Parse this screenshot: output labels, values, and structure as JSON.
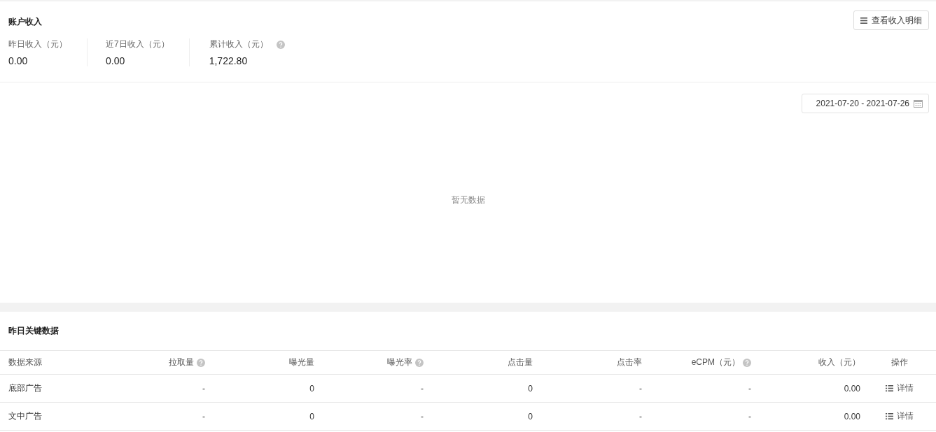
{
  "income": {
    "title": "账户收入",
    "detail_button": "查看收入明细",
    "stats": [
      {
        "label": "昨日收入（元）",
        "value": "0.00",
        "help": false
      },
      {
        "label": "近7日收入（元）",
        "value": "0.00",
        "help": false
      },
      {
        "label": "累计收入（元）",
        "value": "1,722.80",
        "help": true
      }
    ]
  },
  "chart": {
    "date_range": "2021-07-20 - 2021-07-26",
    "empty_text": "暂无数据"
  },
  "key_data": {
    "title": "昨日关键数据",
    "columns": [
      {
        "label": "数据来源",
        "help": false
      },
      {
        "label": "拉取量",
        "help": true
      },
      {
        "label": "曝光量",
        "help": false
      },
      {
        "label": "曝光率",
        "help": true
      },
      {
        "label": "点击量",
        "help": false
      },
      {
        "label": "点击率",
        "help": false
      },
      {
        "label": "eCPM（元）",
        "help": true
      },
      {
        "label": "收入（元）",
        "help": false
      },
      {
        "label": "操作",
        "help": false
      }
    ],
    "rows": [
      {
        "cells": [
          "底部广告",
          "-",
          "0",
          "-",
          "0",
          "-",
          "-",
          "0.00"
        ],
        "action": "详情"
      },
      {
        "cells": [
          "文中广告",
          "-",
          "0",
          "-",
          "0",
          "-",
          "-",
          "0.00"
        ],
        "action": "详情"
      }
    ]
  }
}
